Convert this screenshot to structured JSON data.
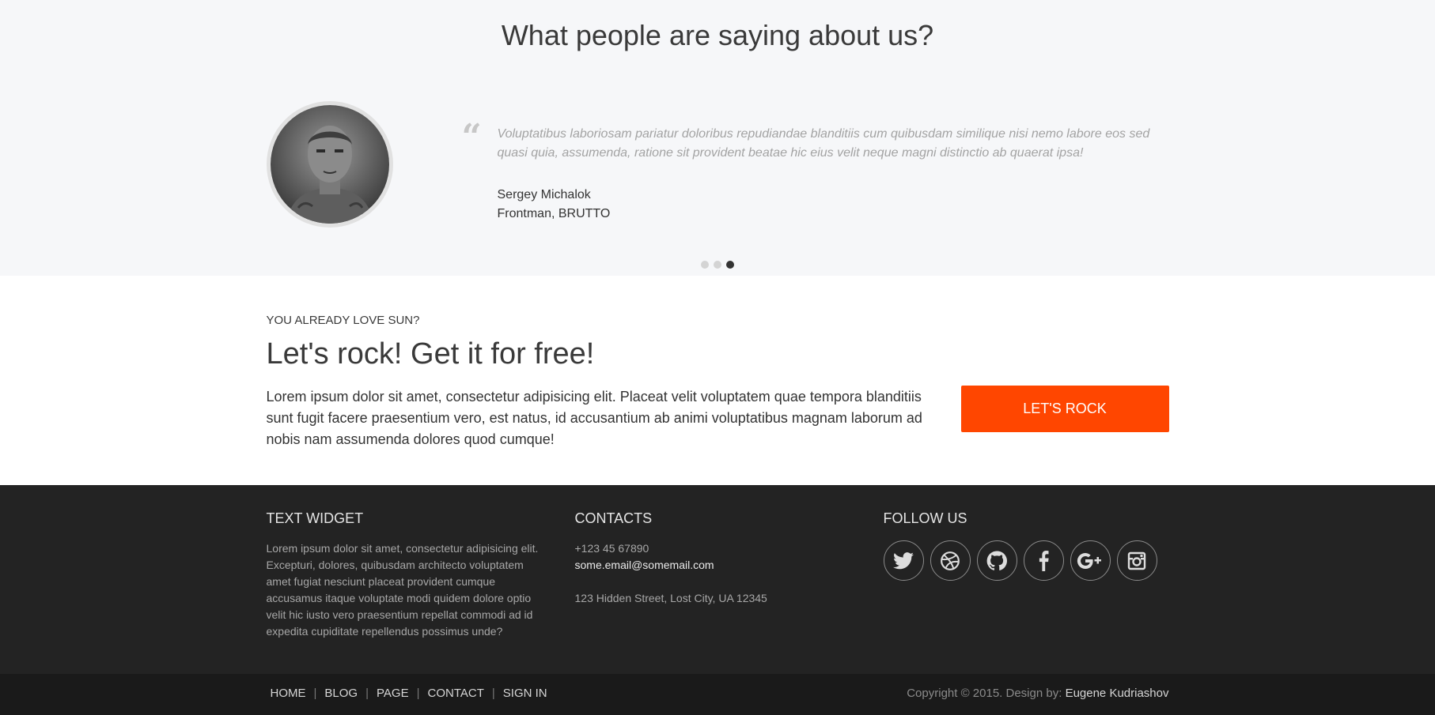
{
  "testimonials": {
    "title": "What people are saying about us?",
    "quote": "Voluptatibus laboriosam pariatur doloribus repudiandae blanditiis cum quibusdam similique nisi nemo labore eos sed quasi quia, assumenda, ratione sit provident beatae hic eius velit neque magni distinctio ab quaerat ipsa!",
    "author_name": "Sergey Michalok",
    "author_role": "Frontman, BRUTTO",
    "quote_icon": "quote-icon",
    "slides": 3,
    "active_slide": 3
  },
  "cta": {
    "eyebrow": "YOU ALREADY LOVE SUN?",
    "heading": "Let's rock! Get it for free!",
    "text": "Lorem ipsum dolor sit amet, consectetur adipisicing elit. Placeat velit voluptatem quae tempora blanditiis sunt fugit facere praesentium vero, est natus, id accusantium ab animi voluptatibus magnam laborum ad nobis nam assumenda dolores quod cumque!",
    "button_label": "LET'S ROCK",
    "button_color": "#ff4600"
  },
  "footer": {
    "text_widget": {
      "title": "TEXT WIDGET",
      "text": "Lorem ipsum dolor sit amet, consectetur adipisicing elit. Excepturi, dolores, quibusdam architecto voluptatem amet fugiat nesciunt placeat provident cumque accusamus itaque voluptate modi quidem dolore optio velit hic iusto vero praesentium repellat commodi ad id expedita cupiditate repellendus possimus unde?"
    },
    "contacts": {
      "title": "CONTACTS",
      "phone": "+123 45 67890",
      "email": "some.email@somemail.com",
      "address": "123 Hidden Street, Lost City, UA 12345"
    },
    "follow": {
      "title": "FOLLOW US",
      "icons": [
        "twitter-icon",
        "dribbble-icon",
        "github-icon",
        "facebook-icon",
        "google-plus-icon",
        "instagram-icon"
      ]
    }
  },
  "bottom": {
    "nav": [
      "HOME",
      "BLOG",
      "PAGE",
      "CONTACT",
      "SIGN IN"
    ],
    "copyright": "Copyright © 2015. Design by:",
    "designer": "Eugene Kudriashov"
  }
}
